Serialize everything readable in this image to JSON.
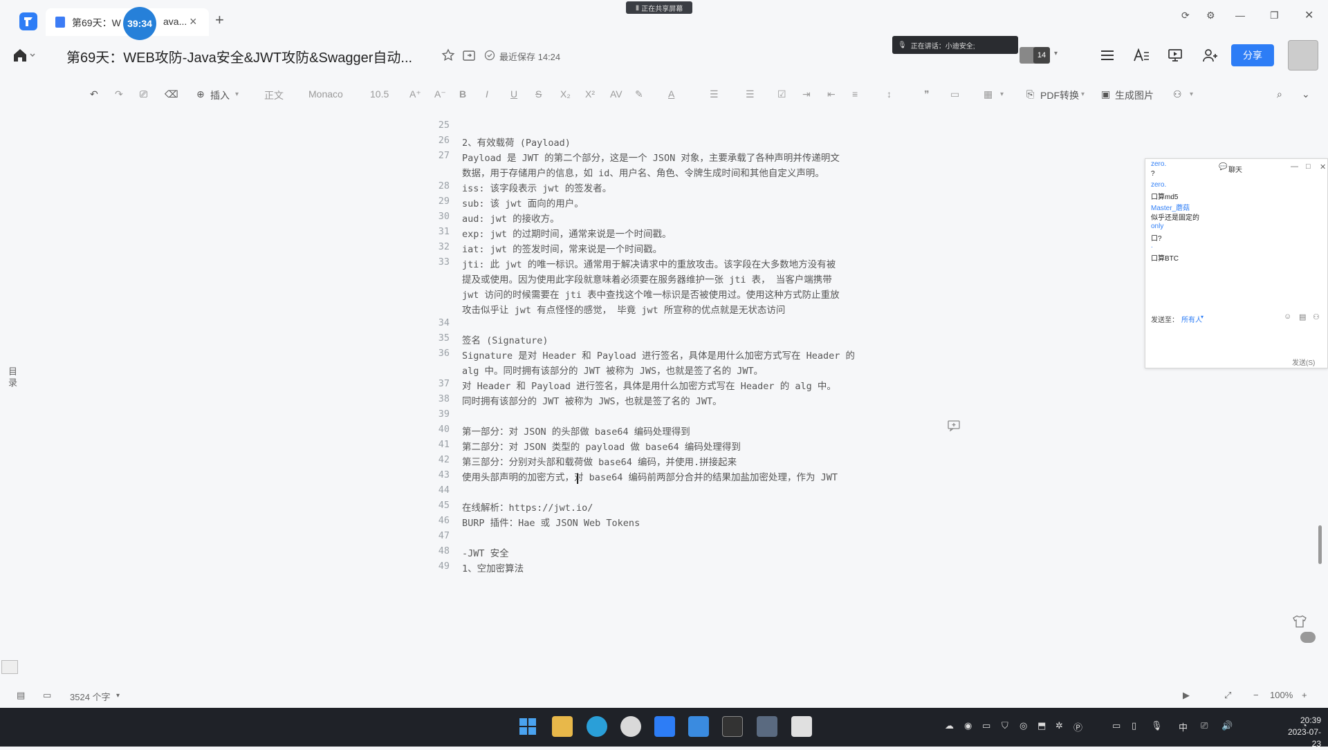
{
  "tab": {
    "title": "第69天：W",
    "title_tail": "ava...",
    "timer": "39:34"
  },
  "screen_share": "正在共享屏幕",
  "doc": {
    "title": "第69天：WEB攻防-Java安全&JWT攻防&Swagger自动...",
    "save_status": "最近保存 14:24"
  },
  "speaking": {
    "label": "正在讲话：小迪安全;"
  },
  "avatars": {
    "count": "14"
  },
  "share_label": "分享",
  "toolbar": {
    "insert": "插入",
    "style": "正文",
    "font": "Monaco",
    "size": "10.5",
    "pdf": "PDF转换",
    "gen_image": "生成图片"
  },
  "toc_label": "目录",
  "lines": [
    {
      "n": "25",
      "t": ""
    },
    {
      "n": "26",
      "t": "2、有效载荷 (Payload)"
    },
    {
      "n": "27",
      "t": "Payload 是 JWT 的第二个部分，这是一个 JSON 对象，主要承载了各种声明并传递明文"
    },
    {
      "n": "",
      "t": "数据，用于存储用户的信息，如 id、用户名、角色、令牌生成时间和其他自定义声明。"
    },
    {
      "n": "28",
      "t": "iss: 该字段表示 jwt 的签发者。"
    },
    {
      "n": "29",
      "t": "sub: 该 jwt 面向的用户。"
    },
    {
      "n": "30",
      "t": "aud: jwt 的接收方。"
    },
    {
      "n": "31",
      "t": "exp: jwt 的过期时间，通常来说是一个时间戳。"
    },
    {
      "n": "32",
      "t": "iat: jwt 的签发时间，常来说是一个时间戳。"
    },
    {
      "n": "33",
      "t": "jti: 此 jwt 的唯一标识。通常用于解决请求中的重放攻击。该字段在大多数地方没有被"
    },
    {
      "n": "",
      "t": "提及或使用。因为使用此字段就意味着必须要在服务器维护一张 jti 表， 当客户端携带"
    },
    {
      "n": "",
      "t": "jwt 访问的时候需要在 jti 表中查找这个唯一标识是否被使用过。使用这种方式防止重放"
    },
    {
      "n": "",
      "t": "攻击似乎让 jwt 有点怪怪的感觉， 毕竟 jwt 所宣称的优点就是无状态访问"
    },
    {
      "n": "34",
      "t": ""
    },
    {
      "n": "35",
      "t": "签名 (Signature)"
    },
    {
      "n": "36",
      "t": "Signature 是对 Header 和 Payload 进行签名，具体是用什么加密方式写在 Header 的"
    },
    {
      "n": "",
      "t": "alg 中。同时拥有该部分的 JWT 被称为 JWS，也就是签了名的 JWT。"
    },
    {
      "n": "37",
      "t": "对 Header 和 Payload 进行签名，具体是用什么加密方式写在 Header 的 alg 中。"
    },
    {
      "n": "38",
      "t": "同时拥有该部分的 JWT 被称为 JWS，也就是签了名的 JWT。"
    },
    {
      "n": "39",
      "t": ""
    },
    {
      "n": "40",
      "t": "第一部分：对 JSON 的头部做 base64 编码处理得到"
    },
    {
      "n": "41",
      "t": "第二部分：对 JSON 类型的 payload 做 base64 编码处理得到"
    },
    {
      "n": "42",
      "t": "第三部分：分别对头部和载荷做 base64 编码，并使用.拼接起来"
    },
    {
      "n": "43",
      "t": "使用头部声明的加密方式，对 base64 编码前两部分合并的结果加盐加密处理，作为 JWT"
    },
    {
      "n": "44",
      "t": ""
    },
    {
      "n": "45",
      "t": "在线解析：https://jwt.io/"
    },
    {
      "n": "46",
      "t": "BURP 插件：Hae 或 JSON Web Tokens"
    },
    {
      "n": "47",
      "t": ""
    },
    {
      "n": "48",
      "t": "-JWT 安全"
    },
    {
      "n": "49",
      "t": "1、空加密算法"
    }
  ],
  "chat": {
    "title": "聊天",
    "messages": [
      {
        "type": "name",
        "text": "zero."
      },
      {
        "type": "text",
        "text": "?"
      },
      {
        "type": "name",
        "text": "zero."
      },
      {
        "type": "text",
        "text": "口算md5"
      },
      {
        "type": "name",
        "text": "Master_蘑菇"
      },
      {
        "type": "text",
        "text": "似乎还是固定的"
      },
      {
        "type": "name",
        "text": "only"
      },
      {
        "type": "text",
        "text": "口?"
      },
      {
        "type": "name",
        "text": "."
      },
      {
        "type": "text",
        "text": "口算BTC"
      }
    ],
    "send_to_label": "发送至：",
    "send_to_value": "所有人",
    "send_label": "发送(S)"
  },
  "status": {
    "word_count": "3524 个字",
    "zoom": "100%"
  },
  "taskbar": {
    "ime": "中",
    "time": "20:39",
    "date": "2023-07-23"
  },
  "colors": {
    "accent": "#2d7df6",
    "taskbar": "#1f2228"
  }
}
